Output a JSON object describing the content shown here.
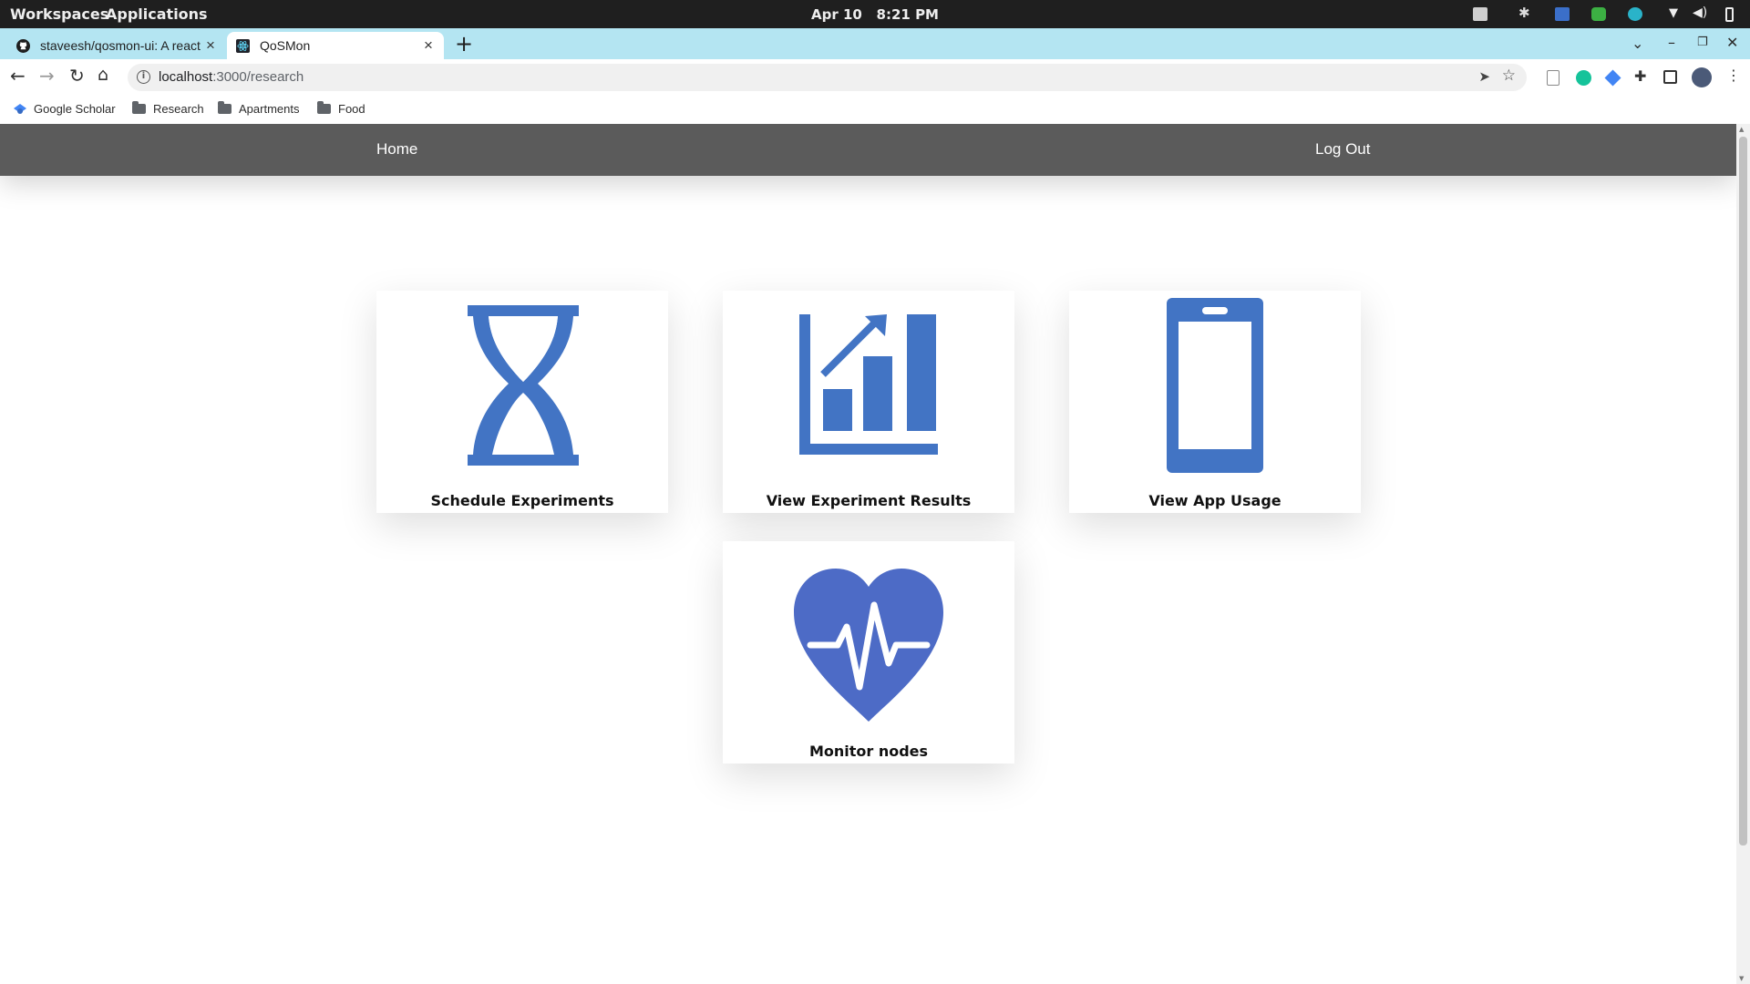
{
  "system_bar": {
    "workspaces": "Workspaces",
    "applications": "Applications",
    "date": "Apr 10",
    "time": "8:21 PM"
  },
  "browser": {
    "tabs": [
      {
        "title": "staveesh/qosmon-ui: A react",
        "icon": "github-icon",
        "active": false
      },
      {
        "title": "QoSMon",
        "icon": "react-icon",
        "active": true
      }
    ],
    "url_host": "localhost",
    "url_path": ":3000/research",
    "bookmarks": [
      "Google Scholar",
      "Research",
      "Apartments",
      "Food"
    ]
  },
  "nav": {
    "home": "Home",
    "logout": "Log Out"
  },
  "cards": [
    {
      "label": "Schedule Experiments",
      "icon": "hourglass-icon"
    },
    {
      "label": "View Experiment Results",
      "icon": "bar-chart-growth-icon"
    },
    {
      "label": "View App Usage",
      "icon": "smartphone-icon"
    },
    {
      "label": "Monitor nodes",
      "icon": "heartbeat-icon"
    }
  ],
  "colors": {
    "icon_blue": "#4274c4",
    "heart_blue": "#4d6bc6",
    "nav_gray": "#5b5b5b",
    "tab_strip": "#b4e5f2"
  }
}
